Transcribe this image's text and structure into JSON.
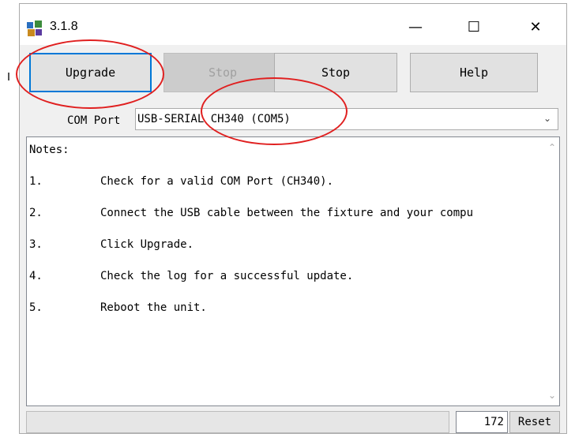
{
  "window": {
    "title": "3.1.8",
    "controls": {
      "minimize": "—",
      "maximize": "☐",
      "close": "✕"
    }
  },
  "toolbar": {
    "upgrade_label": "Upgrade",
    "stop_disabled_label": "Stop",
    "stop_label": "Stop",
    "help_label": "Help"
  },
  "com_port": {
    "label": "COM Port",
    "selected": "USB-SERIAL CH340 (COM5)"
  },
  "notes": {
    "header": "Notes:",
    "items": [
      {
        "num": "1.",
        "text": "Check for a valid COM Port (CH340)."
      },
      {
        "num": "2.",
        "text": "Connect the USB cable between the fixture and your compu"
      },
      {
        "num": "3.",
        "text": "Click Upgrade."
      },
      {
        "num": "4.",
        "text": "Check the log for a successful update."
      },
      {
        "num": "5.",
        "text": "Reboot the unit."
      }
    ]
  },
  "status": {
    "counter": "172",
    "reset_label": "Reset"
  },
  "colors": {
    "annotation": "#e02020",
    "focus_border": "#0078d7"
  }
}
